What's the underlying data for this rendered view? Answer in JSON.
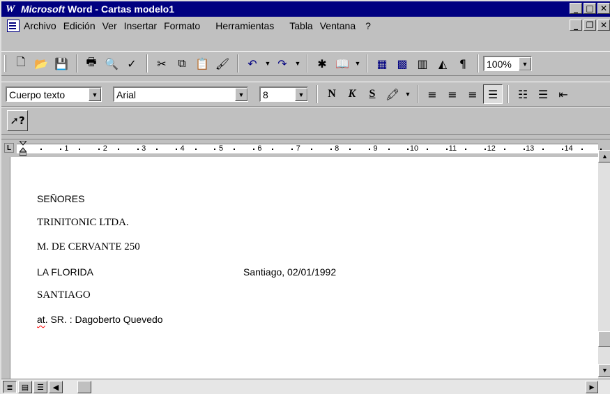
{
  "titlebar": {
    "app_logo": "W",
    "brand": "Microsoft",
    "title": "Word - Cartas modelo1",
    "minimize": "_",
    "maximize": "□",
    "close": "✕"
  },
  "menubar": {
    "items": [
      "Archivo",
      "Edición",
      "Ver",
      "Insertar",
      "Formato",
      "Herramientas",
      "Tabla",
      "Ventana",
      "?"
    ],
    "doc_minimize": "_",
    "doc_restore": "❐",
    "doc_close": "✕"
  },
  "standard_toolbar": {
    "zoom": "100%"
  },
  "formatting_toolbar": {
    "style": "Cuerpo texto",
    "font": "Arial",
    "size": "8",
    "bold_label": "N",
    "italic_label": "K",
    "underline_label": "S"
  },
  "help_toolbar": {
    "help_label": "?"
  },
  "ruler": {
    "tab_label": "L",
    "numbers": [
      "1",
      "2",
      "3",
      "4",
      "5",
      "6",
      "7",
      "8",
      "9",
      "10",
      "11",
      "12",
      "13",
      "14"
    ]
  },
  "document": {
    "line1": "SEÑORES",
    "line2": "TRINITONIC LTDA.",
    "line3": "M. DE CERVANTE 250",
    "line4": "LA FLORIDA",
    "date": "Santiago, 02/01/1992",
    "line5": "SANTIAGO",
    "att_prefix": "at",
    "att_rest": ". SR. : Dagoberto Quevedo"
  },
  "colors": {
    "titlebar": "#000080",
    "chrome": "#c0c0c0",
    "spellcheck": "#ff0000"
  }
}
